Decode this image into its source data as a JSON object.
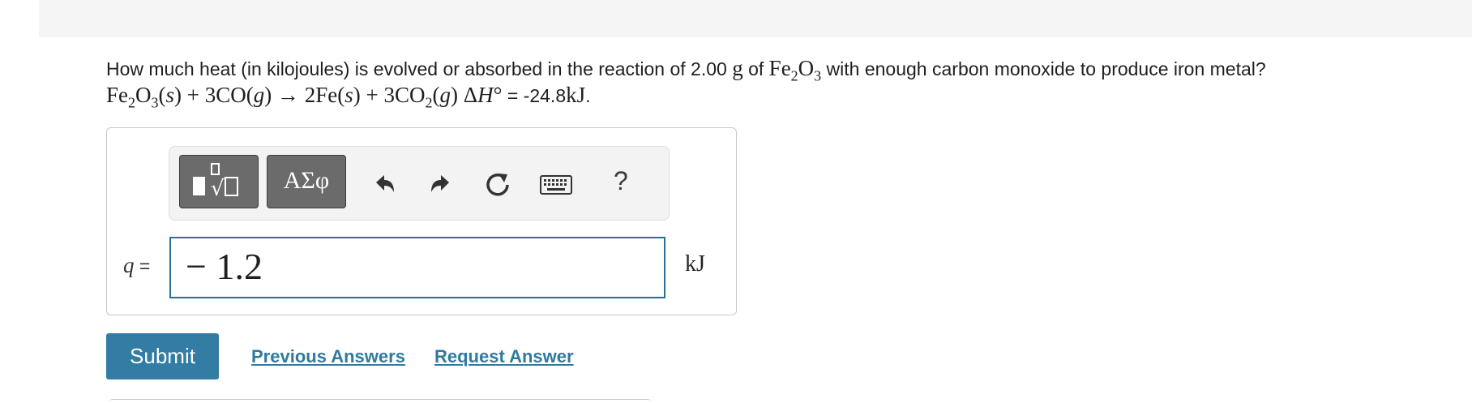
{
  "question": {
    "prefix": "How much heat (in kilojoules) is evolved or absorbed in the reaction of 2.00 ",
    "mass_unit": "g",
    "of_text": " of ",
    "fe": "Fe",
    "fe_sub": "2",
    "o": "O",
    "o_sub": "3",
    "suffix": " with enough carbon monoxide to produce iron metal?"
  },
  "equation": {
    "r1_fe": "Fe",
    "r1_fe_sub": "2",
    "r1_o": "O",
    "r1_o_sub": "3",
    "r1_state_open": "(",
    "r1_state": "s",
    "r1_state_close": ")",
    "plus1": " + ",
    "r2": "3CO",
    "r2_state_open": "(",
    "r2_state": "g",
    "r2_state_close": ")",
    "arrow": " → ",
    "p1": "2Fe",
    "p1_state_open": "(",
    "p1_state": "s",
    "p1_state_close": ")",
    "plus2": " + ",
    "p2": "3CO",
    "p2_sub": "2",
    "p2_state_open": "(",
    "p2_state": "g",
    "p2_state_close": ")",
    "delta": " Δ",
    "h": "H",
    "degree": "°",
    "equals": " = ",
    "value": "-24.8",
    "unit": "kJ",
    "period": "."
  },
  "toolbar": {
    "templates_icon": "templates-icon",
    "symbols_label": "ΑΣφ",
    "undo_icon": "undo-icon",
    "redo_icon": "redo-icon",
    "reset_icon": "reset-icon",
    "keyboard_icon": "keyboard-icon",
    "help_label": "?"
  },
  "answer": {
    "variable": "q",
    "equals": " =",
    "value": "− 1.2",
    "unit": "kJ"
  },
  "actions": {
    "submit_label": "Submit",
    "previous_answers_label": "Previous Answers",
    "request_answer_label": "Request Answer"
  },
  "colors": {
    "accent": "#337ca3",
    "link": "#2f7aa0",
    "toolbar_button": "#6b6b6b",
    "input_border": "#2d6f8e"
  }
}
